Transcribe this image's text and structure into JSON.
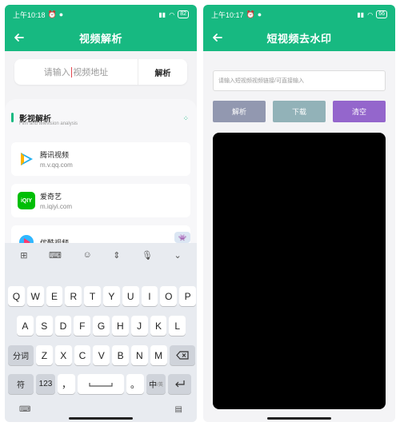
{
  "left_screen": {
    "status": {
      "time": "上午10:18",
      "battery": "82"
    },
    "appbar": {
      "title": "视频解析"
    },
    "search": {
      "placeholder_before": "请输入",
      "placeholder_after": "视频地址",
      "parse_label": "解析"
    },
    "section": {
      "title": "影视解析",
      "subtitle": "Film and television analysis"
    },
    "sites": [
      {
        "name": "腾讯视频",
        "url": "m.v.qq.com",
        "logo_text": "▶",
        "logo_color": "#22b0ef"
      },
      {
        "name": "爱奇艺",
        "url": "m.iqiyi.com",
        "logo_text": "iQIY",
        "logo_color": "#00be06"
      },
      {
        "name": "优酷视频",
        "url": "",
        "logo_text": "▶",
        "logo_color": "#ff4f63"
      }
    ],
    "keyboard": {
      "row1": [
        "Q",
        "W",
        "E",
        "R",
        "T",
        "Y",
        "U",
        "I",
        "O",
        "P"
      ],
      "row1_sup": [
        "1",
        "2",
        "3",
        "4",
        "5",
        "6",
        "7",
        "8",
        "9",
        "0"
      ],
      "row2": [
        "A",
        "S",
        "D",
        "F",
        "G",
        "H",
        "J",
        "K",
        "L"
      ],
      "row3": [
        "Z",
        "X",
        "C",
        "V",
        "B",
        "N",
        "M"
      ],
      "fenci": "分词",
      "fu": "符",
      "num": "123",
      "comma": "，",
      "period": "。",
      "zhong": "中",
      "zhong_sub": "/英"
    }
  },
  "right_screen": {
    "status": {
      "time": "上午10:17",
      "battery": "66"
    },
    "appbar": {
      "title": "短视频去水印"
    },
    "input_placeholder": "请输入短视频视频链接/可直接输入",
    "buttons": [
      {
        "label": "解析",
        "color": "#9298b0"
      },
      {
        "label": "下载",
        "color": "#92b2b8"
      },
      {
        "label": "清空",
        "color": "#9466cc"
      }
    ]
  },
  "colors": {
    "accent": "#17b981"
  }
}
